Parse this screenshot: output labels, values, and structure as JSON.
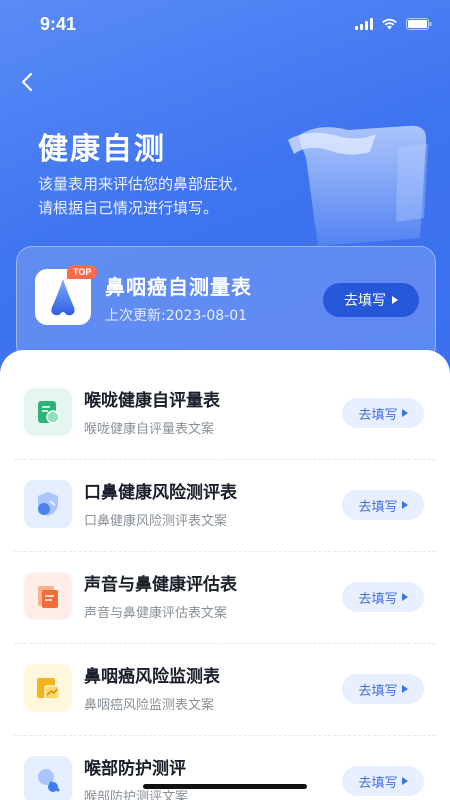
{
  "status_bar": {
    "time": "9:41"
  },
  "header": {
    "title": "健康自测",
    "description_line1": "该量表用来评估您的鼻部症状,",
    "description_line2": "请根据自己情况进行填写。"
  },
  "top_card": {
    "badge": "TOP",
    "title": "鼻咽癌自测量表",
    "updated": "上次更新:2023-08-01",
    "button": "去填写"
  },
  "list": [
    {
      "title": "喉咙健康自评量表",
      "desc": "喉咙健康自评量表文案",
      "button": "去填写",
      "icon": "throat-form-icon",
      "color": "#2fb37a",
      "bg": "#e4f6ee"
    },
    {
      "title": "口鼻健康风险测评表",
      "desc": "口鼻健康风险测评表文案",
      "button": "去填写",
      "icon": "shield-icon",
      "color": "#4a82f0",
      "bg": "#e6efff"
    },
    {
      "title": "声音与鼻健康评估表",
      "desc": "声音与鼻健康评估表文案",
      "button": "去填写",
      "icon": "document-icon",
      "color": "#f26c3c",
      "bg": "#ffeee6"
    },
    {
      "title": "鼻咽癌风险监测表",
      "desc": "鼻咽癌风险监测表文案",
      "button": "去填写",
      "icon": "chart-icon",
      "color": "#f2b51e",
      "bg": "#fff6dc"
    },
    {
      "title": "喉部防护测评",
      "desc": "喉部防护测评文案",
      "button": "去填写",
      "icon": "search-icon",
      "color": "#3e7cf0",
      "bg": "#e6efff"
    }
  ]
}
